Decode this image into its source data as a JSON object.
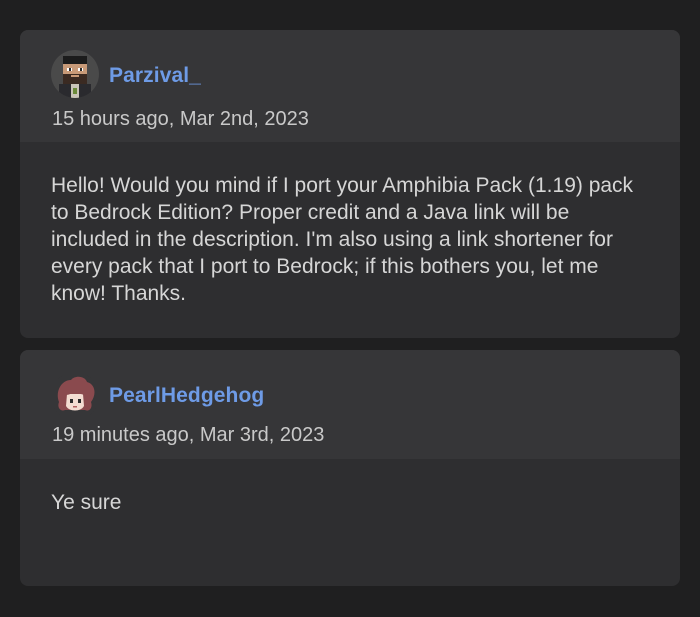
{
  "comments": [
    {
      "username": "Parzival_",
      "timestamp": "15 hours ago, Mar 2nd, 2023",
      "text": "Hello! Would you mind if I port your Amphibia Pack (1.19) pack to Bedrock Edition? Proper credit and a Java link will be included in the description. I'm also using a link shortener for every pack that I port to Bedrock; if this bothers you, let me know! Thanks.",
      "avatar_icon": "pixel-minecraft-skin-avatar-icon"
    },
    {
      "username": "PearlHedgehog",
      "timestamp": "19 minutes ago, Mar 3rd, 2023",
      "text": "Ye sure",
      "avatar_icon": "red-haired-cartoon-avatar-icon"
    }
  ],
  "colors": {
    "page_background": "#1f1f20",
    "card_background": "#2e2e30",
    "card_header_background": "#363638",
    "username": "#6e9be6",
    "text": "#d6d6d6"
  }
}
